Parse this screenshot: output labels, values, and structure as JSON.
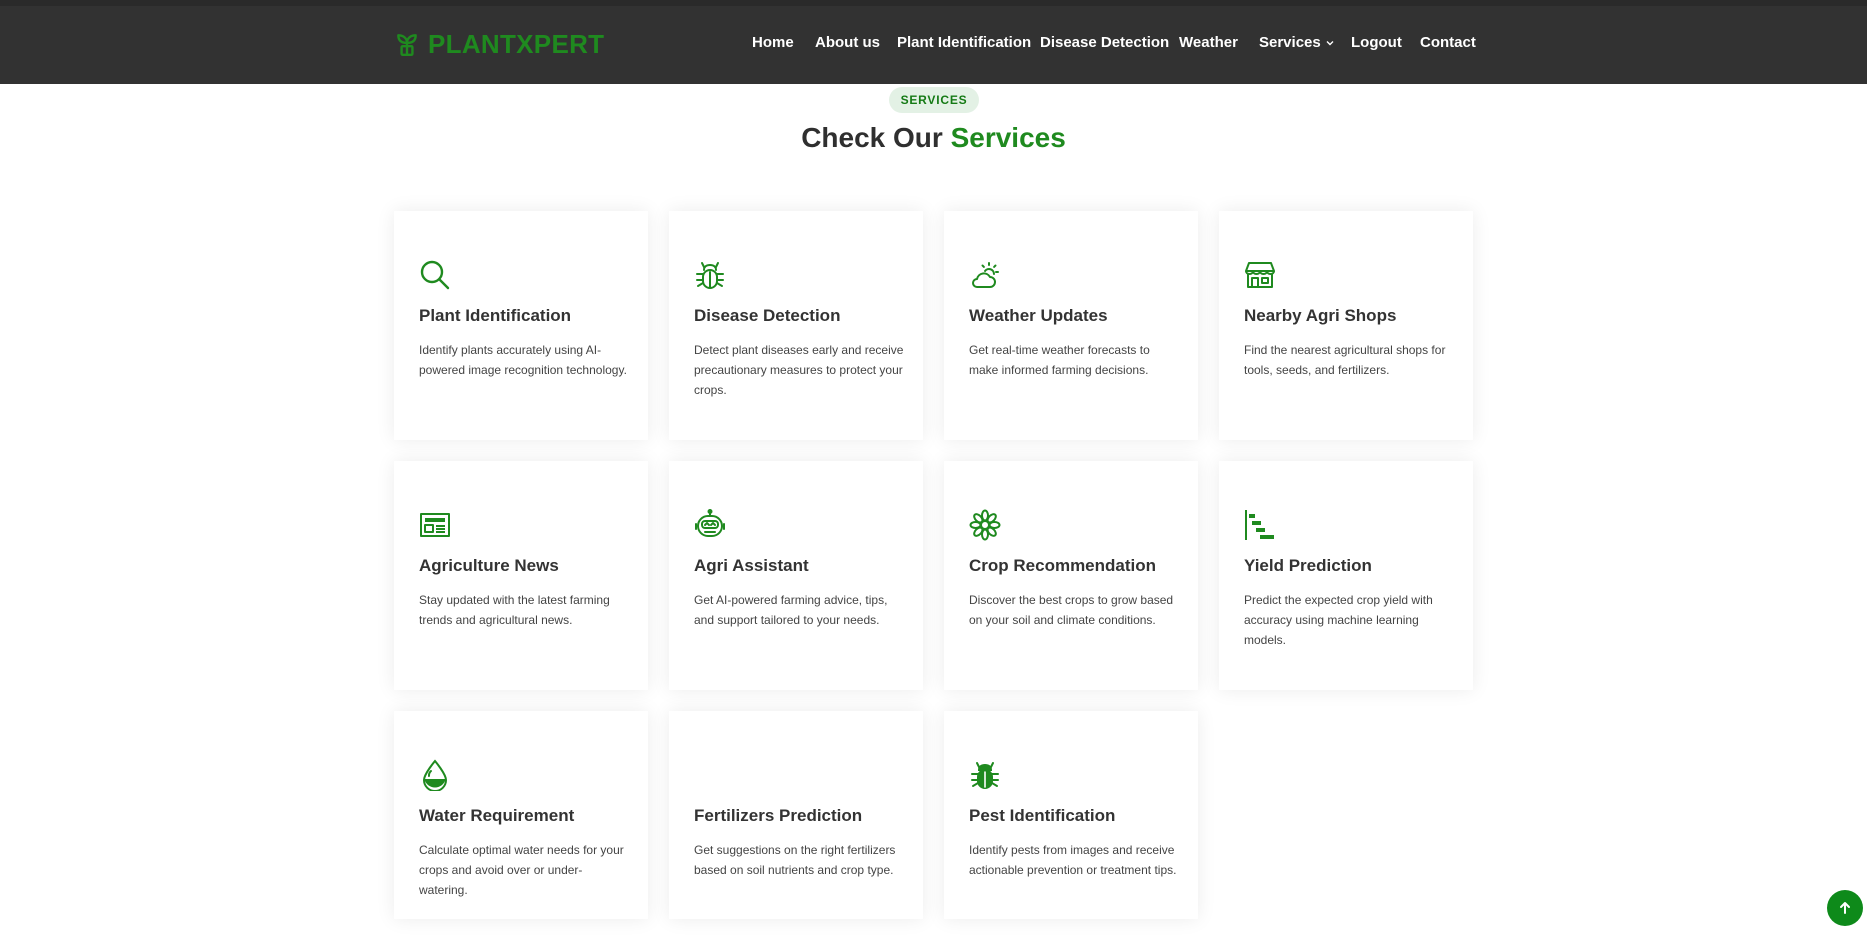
{
  "brand": {
    "name": "PLANTXPERT",
    "logo_icon": "sprout-icon",
    "color": "#1f8a1f"
  },
  "nav": {
    "items": [
      "Home",
      "About us",
      "Plant Identification",
      "Disease Detection",
      "Weather",
      "Services",
      "Logout",
      "Contact"
    ],
    "services_dropdown_icon": "chevron-down-icon"
  },
  "section": {
    "badge": "SERVICES",
    "title_prefix": "Check Our",
    "title_accent": "Services"
  },
  "cards": [
    {
      "title": "Plant Identification",
      "desc": "Identify plants accurately using AI-powered image recognition technology.",
      "icon": "search-icon"
    },
    {
      "title": "Disease Detection",
      "desc": "Detect plant diseases early and receive precautionary measures to protect your crops.",
      "icon": "bug-icon"
    },
    {
      "title": "Weather Updates",
      "desc": "Get real-time weather forecasts to make informed farming decisions.",
      "icon": "cloud-sun-icon"
    },
    {
      "title": "Nearby Agri Shops",
      "desc": "Find the nearest agricultural shops for tools, seeds, and fertilizers.",
      "icon": "shop-icon"
    },
    {
      "title": "Agriculture News",
      "desc": "Stay updated with the latest farming trends and agricultural news.",
      "icon": "newspaper-icon"
    },
    {
      "title": "Agri Assistant",
      "desc": "Get AI-powered farming advice, tips, and support tailored to your needs.",
      "icon": "robot-icon"
    },
    {
      "title": "Crop Recommendation",
      "desc": "Discover the best crops to grow based on your soil and climate conditions.",
      "icon": "flower-icon"
    },
    {
      "title": "Yield Prediction",
      "desc": "Predict the expected crop yield with accuracy using machine learning models.",
      "icon": "bar-chart-steps-icon"
    },
    {
      "title": "Water Requirement",
      "desc": "Calculate optimal water needs for your crops and avoid over or under-watering.",
      "icon": "droplet-half-icon"
    },
    {
      "title": "Fertilizers Prediction",
      "desc": "Get suggestions on the right fertilizers based on soil nutrients and crop type.",
      "icon": ""
    },
    {
      "title": "Pest Identification",
      "desc": "Identify pests from images and receive actionable prevention or treatment tips.",
      "icon": "bug-fill-icon"
    }
  ],
  "back_to_top_icon": "arrow-up-icon",
  "colors": {
    "header_bg": "#323232",
    "accent": "#1f8a1f",
    "badge_bg": "#e3f1e5",
    "button_bg": "#0e8a1a"
  }
}
